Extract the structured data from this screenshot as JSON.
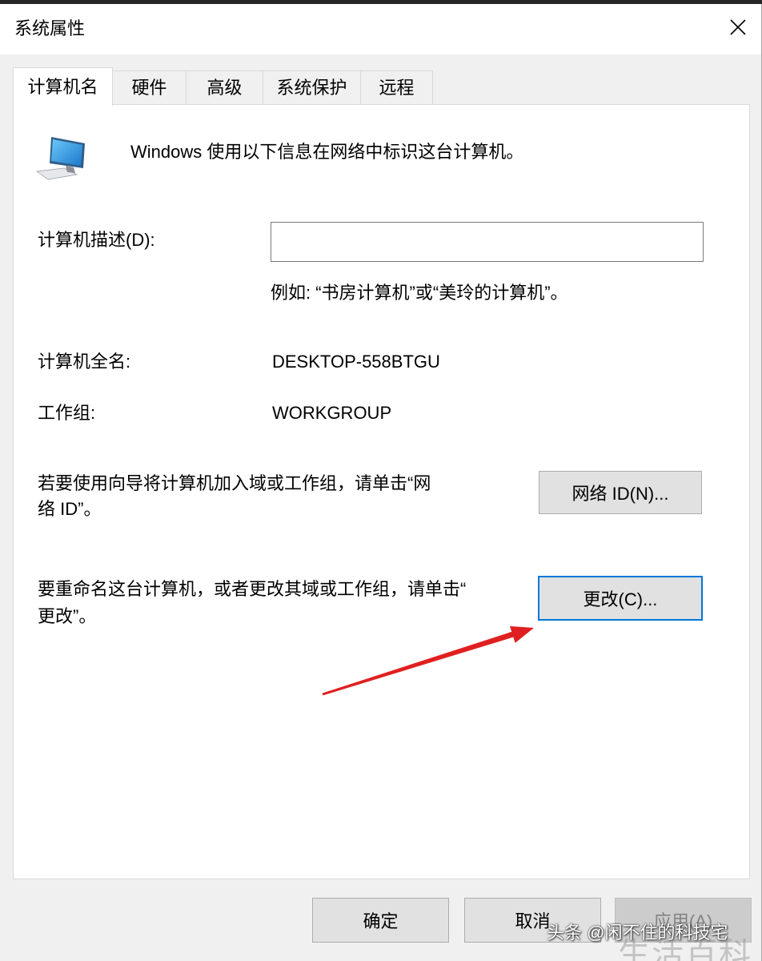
{
  "window": {
    "title": "系统属性",
    "close_icon": "close-icon"
  },
  "tabs": [
    {
      "label": "计算机名",
      "selected": true
    },
    {
      "label": "硬件",
      "selected": false
    },
    {
      "label": "高级",
      "selected": false
    },
    {
      "label": "系统保护",
      "selected": false
    },
    {
      "label": "远程",
      "selected": false
    }
  ],
  "computer_name": {
    "icon": "computer-icon",
    "intro": "Windows 使用以下信息在网络中标识这台计算机。",
    "description": {
      "label": "计算机描述(D):",
      "value": "",
      "hint": "例如: “书房计算机”或“美玲的计算机”。"
    },
    "full_name": {
      "label": "计算机全名:",
      "value": "DESKTOP-558BTGU"
    },
    "workgroup": {
      "label": "工作组:",
      "value": "WORKGROUP"
    },
    "network_id": {
      "text_lines": [
        "若要使用向导将计算机加入域或工作组，请单击“网",
        "络 ID”。"
      ],
      "button_label": "网络 ID(N)..."
    },
    "rename": {
      "text_lines": [
        "要重命名这台计算机，或者更改其域或工作组，请单击“",
        "更改”。"
      ],
      "button_label": "更改(C)...",
      "focused": true
    }
  },
  "annotation": {
    "icon": "red-arrow-icon"
  },
  "footer": {
    "ok_label": "确定",
    "cancel_label": "取消",
    "apply_label": "应用(A)",
    "apply_enabled": false
  },
  "watermark": {
    "source": "头条 @闲不住的科技宅",
    "overlay": "生活百科"
  },
  "colors": {
    "focus_border": "#0078d7",
    "annotation_arrow": "#e02020",
    "disabled_text": "#838383"
  }
}
